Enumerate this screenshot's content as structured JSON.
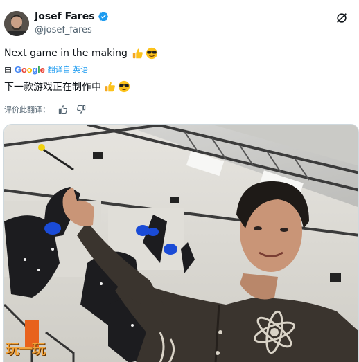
{
  "author": {
    "display_name": "Josef Fares",
    "handle": "@josef_fares"
  },
  "tweet": {
    "text": "Next game in the making",
    "emojis": [
      "thumbs-up",
      "sunglasses-face"
    ]
  },
  "translation": {
    "by_label": "由",
    "google_letters": [
      "G",
      "o",
      "o",
      "g",
      "l",
      "e"
    ],
    "google_colors": [
      "#4285F4",
      "#EA4335",
      "#FBBC05",
      "#4285F4",
      "#34A853",
      "#EA4335"
    ],
    "translated_from_label": "翻译自 英语",
    "translated_text": "下一款游戏正在制作中",
    "rate_label": "评价此翻译："
  },
  "watermark": {
    "text": "玩一玩"
  },
  "colors": {
    "link": "#1d9bf0",
    "verified": "#1d9bf0",
    "secondary_text": "#536471",
    "watermark": "#f2a33a"
  },
  "icons": {
    "verified": "verified-badge-icon",
    "grok": "grok-icon",
    "rate_good": "thumbs-up-outline-icon",
    "rate_bad": "thumbs-down-outline-icon"
  }
}
